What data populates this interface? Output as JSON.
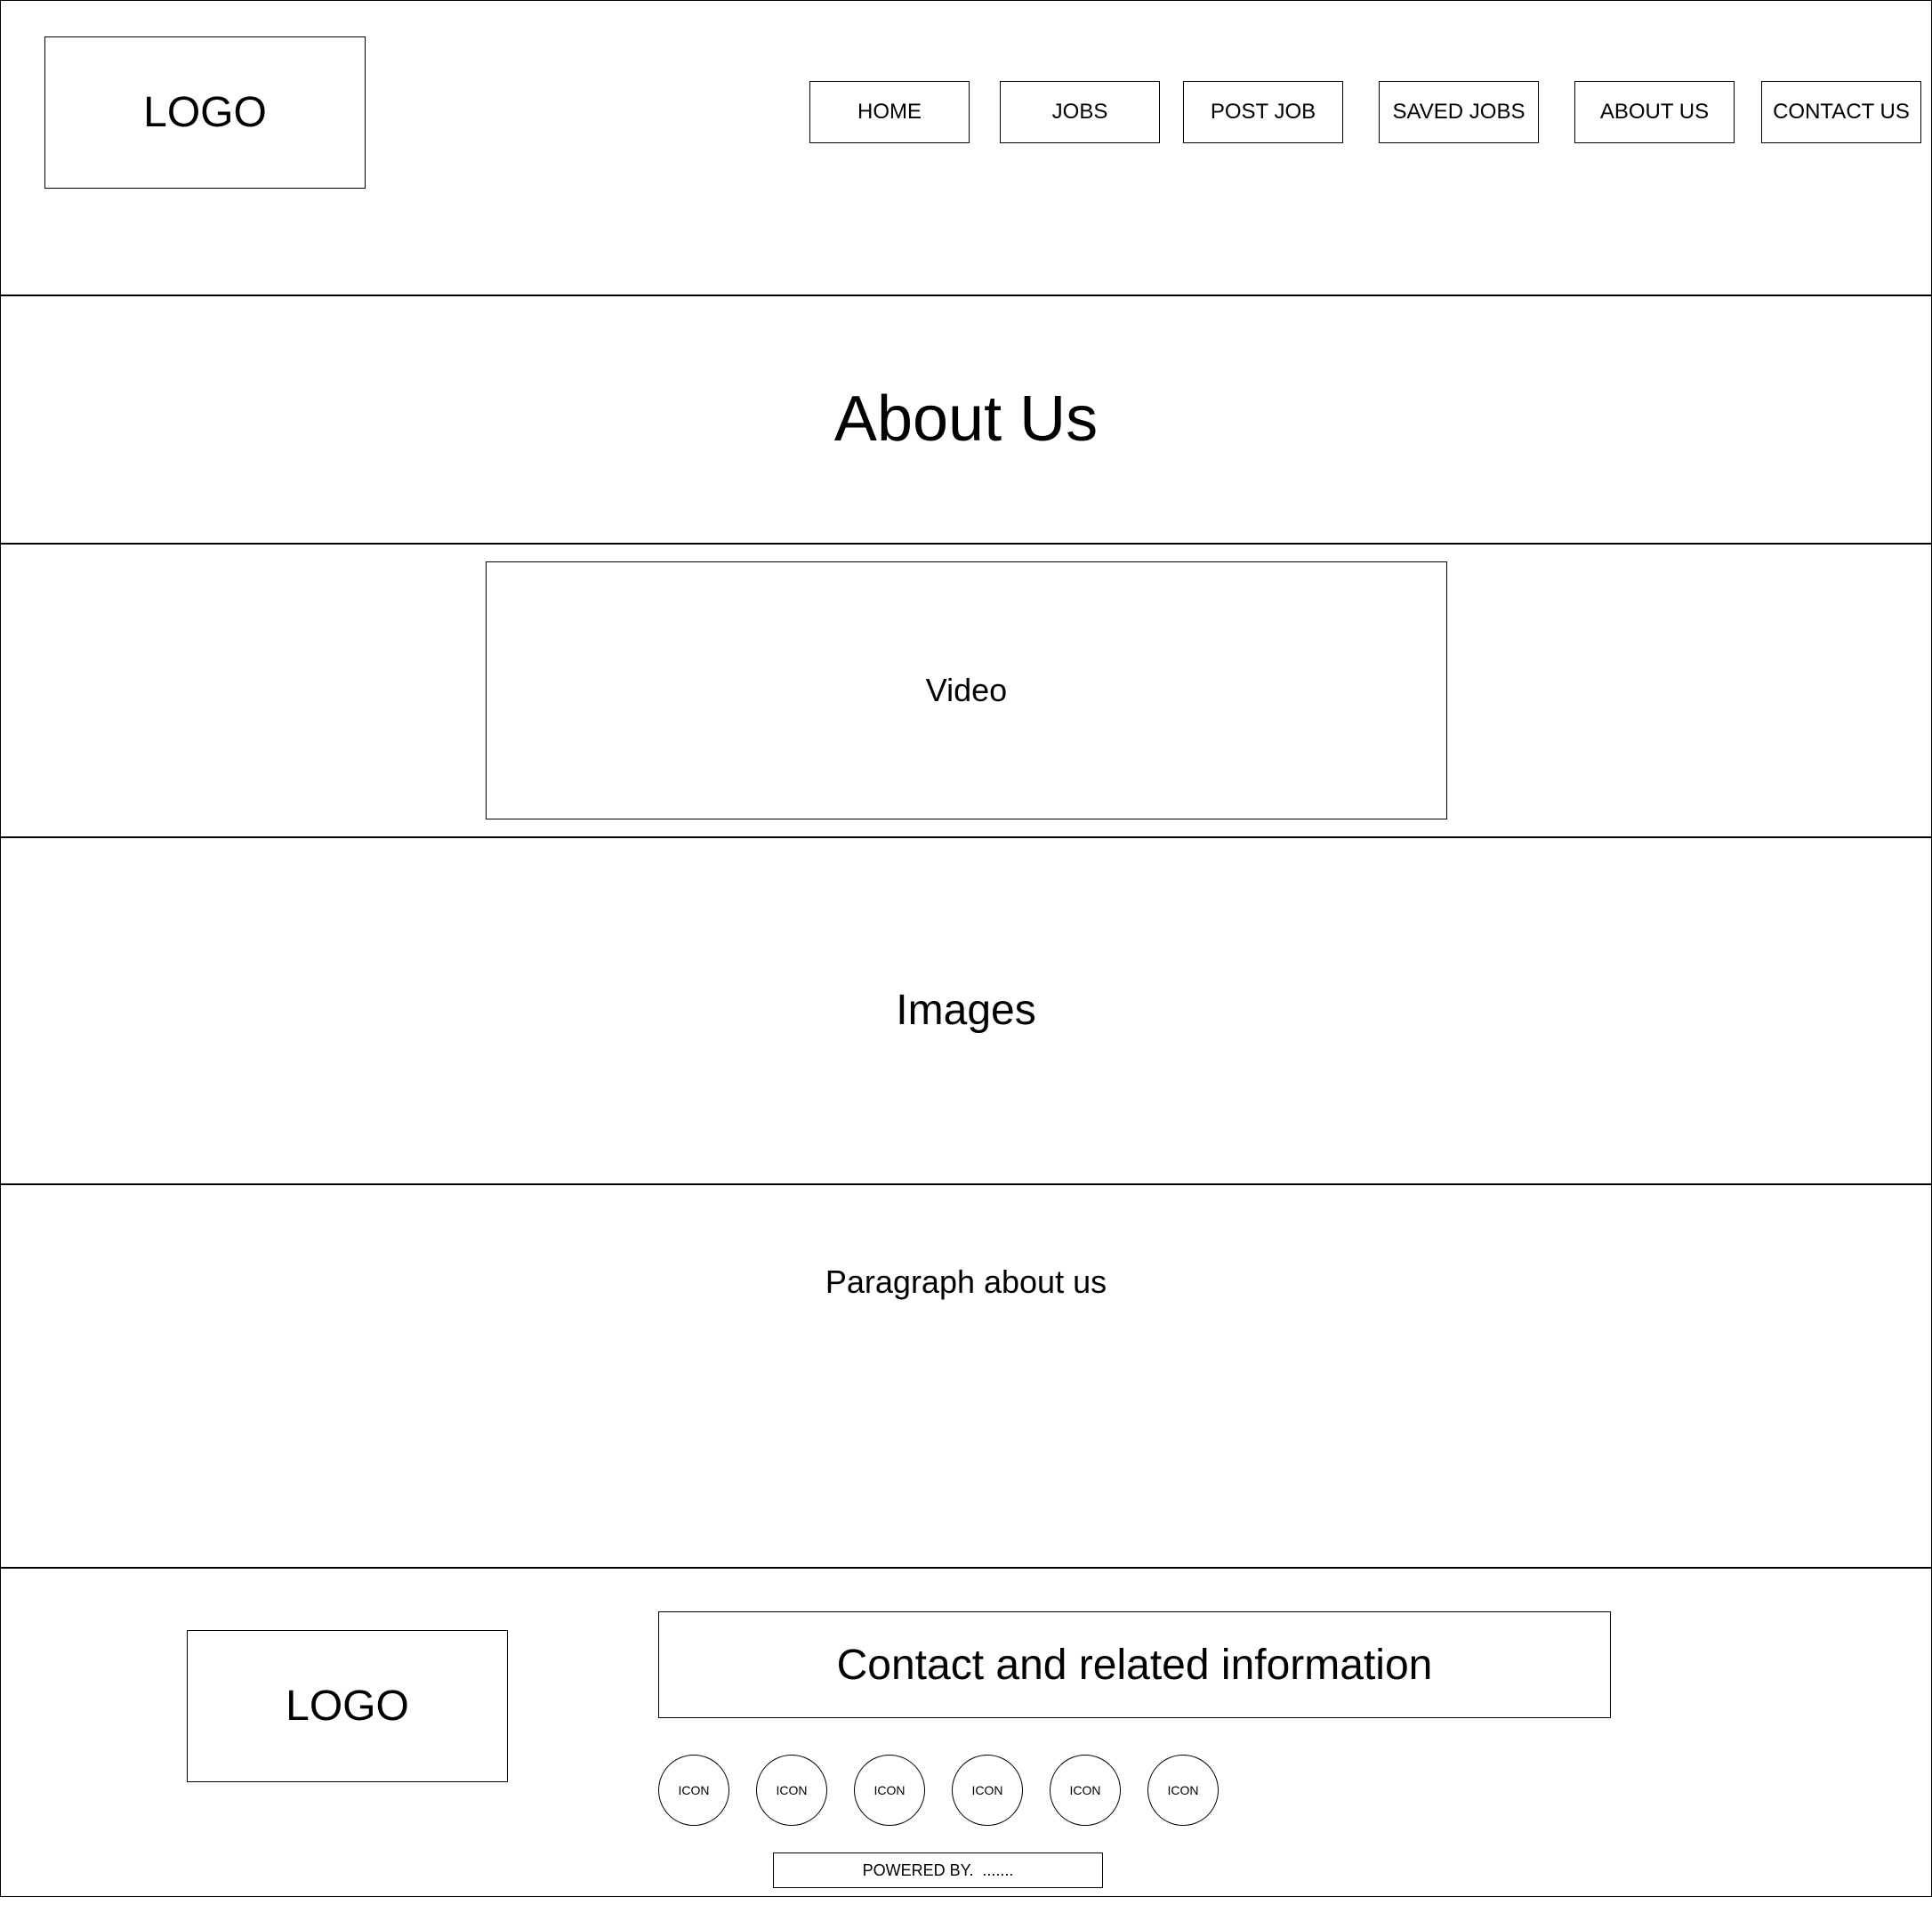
{
  "header": {
    "logo": "LOGO",
    "nav": [
      "HOME",
      "JOBS",
      "POST JOB",
      "SAVED JOBS",
      "ABOUT US",
      "CONTACT US"
    ]
  },
  "hero": {
    "title": "About Us"
  },
  "video": {
    "label": "Video"
  },
  "images": {
    "label": "Images"
  },
  "paragraph": {
    "label": "Paragraph about us"
  },
  "footer": {
    "logo": "LOGO",
    "contact": "Contact and related information",
    "icons": [
      "ICON",
      "ICON",
      "ICON",
      "ICON",
      "ICON",
      "ICON"
    ],
    "powered": "POWERED BY.  ......."
  }
}
